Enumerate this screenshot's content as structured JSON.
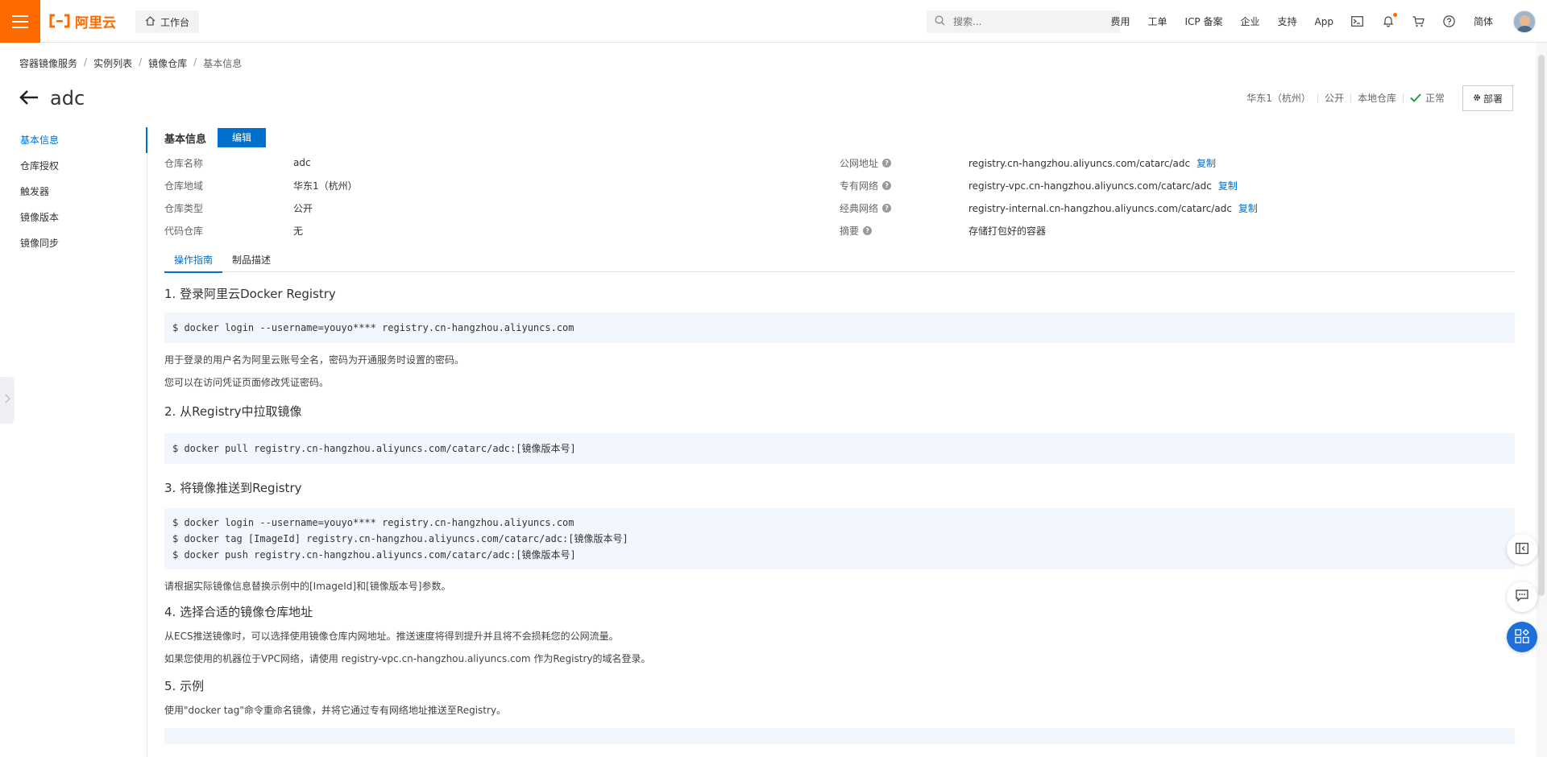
{
  "topbar": {
    "logo_text": "阿里云",
    "workbench_label": "工作台",
    "search_placeholder": "搜索...",
    "nav_items": [
      "费用",
      "工单",
      "ICP 备案",
      "企业",
      "支持",
      "App"
    ],
    "lang_label": "简体"
  },
  "breadcrumb": [
    "容器镜像服务",
    "实例列表",
    "镜像仓库",
    "基本信息"
  ],
  "page_title": "adc",
  "status": {
    "region": "华东1（杭州）",
    "visibility": "公开",
    "repo_kind": "本地仓库",
    "state": "正常",
    "deploy_label": "部署"
  },
  "sidebar": {
    "items": [
      "基本信息",
      "仓库授权",
      "触发器",
      "镜像版本",
      "镜像同步"
    ]
  },
  "basic_info": {
    "heading": "基本信息",
    "edit_label": "编辑",
    "left": [
      {
        "label": "仓库名称",
        "value": "adc"
      },
      {
        "label": "仓库地域",
        "value": "华东1（杭州）"
      },
      {
        "label": "仓库类型",
        "value": "公开"
      },
      {
        "label": "代码仓库",
        "value": "无"
      }
    ],
    "right": [
      {
        "label": "公网地址",
        "value": "registry.cn-hangzhou.aliyuncs.com/catarc/adc",
        "copy": "复制"
      },
      {
        "label": "专有网络",
        "value": "registry-vpc.cn-hangzhou.aliyuncs.com/catarc/adc",
        "copy": "复制"
      },
      {
        "label": "经典网络",
        "value": "registry-internal.cn-hangzhou.aliyuncs.com/catarc/adc",
        "copy": "复制"
      },
      {
        "label": "摘要",
        "value": "存储打包好的容器"
      }
    ]
  },
  "tabs": [
    "操作指南",
    "制品描述"
  ],
  "guide": {
    "s1_title": "1. 登录阿里云Docker Registry",
    "s1_code": [
      "$ docker login --username=youyo**** registry.cn-hangzhou.aliyuncs.com"
    ],
    "s1_p1": "用于登录的用户名为阿里云账号全名，密码为开通服务时设置的密码。",
    "s1_p2": "您可以在访问凭证页面修改凭证密码。",
    "s2_title": "2. 从Registry中拉取镜像",
    "s2_code": [
      "$ docker pull registry.cn-hangzhou.aliyuncs.com/catarc/adc:[镜像版本号]"
    ],
    "s3_title": "3. 将镜像推送到Registry",
    "s3_code": [
      "$ docker login --username=youyo**** registry.cn-hangzhou.aliyuncs.com",
      "$ docker tag [ImageId] registry.cn-hangzhou.aliyuncs.com/catarc/adc:[镜像版本号]",
      "$ docker push registry.cn-hangzhou.aliyuncs.com/catarc/adc:[镜像版本号]"
    ],
    "s3_p1": "请根据实际镜像信息替换示例中的[ImageId]和[镜像版本号]参数。",
    "s4_title": "4. 选择合适的镜像仓库地址",
    "s4_p1": "从ECS推送镜像时，可以选择使用镜像仓库内网地址。推送速度将得到提升并且将不会损耗您的公网流量。",
    "s4_p2": "如果您使用的机器位于VPC网络，请使用 registry-vpc.cn-hangzhou.aliyuncs.com 作为Registry的域名登录。",
    "s5_title": "5. 示例",
    "s5_p1": "使用\"docker tag\"命令重命名镜像，并将它通过专有网络地址推送至Registry。"
  },
  "colors": {
    "brand": "#ff6a00",
    "primary": "#0070cc",
    "code_bg": "#f2f7fd"
  }
}
